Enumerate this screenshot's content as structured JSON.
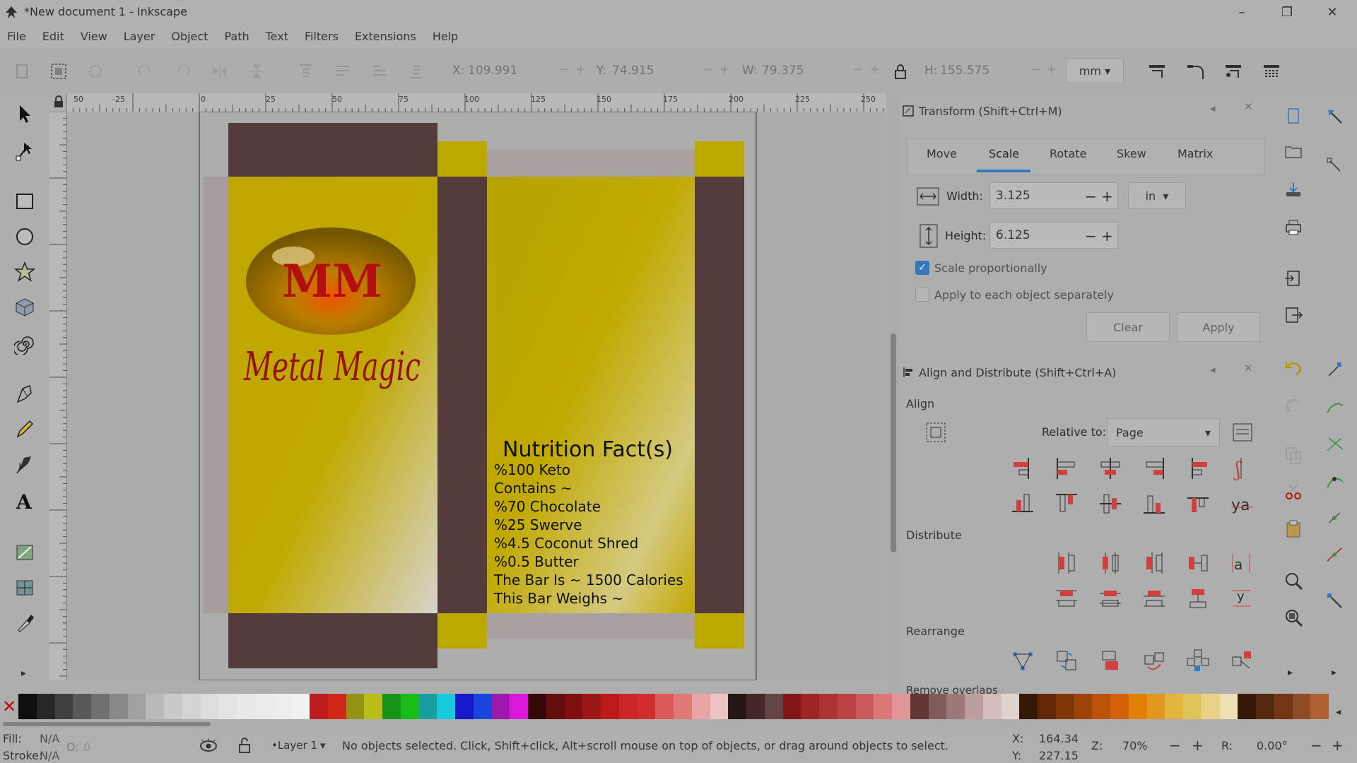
{
  "window": {
    "title": "*New document 1 - Inkscape",
    "controls": [
      "–",
      "❐",
      "✕"
    ]
  },
  "menu": [
    "File",
    "Edit",
    "View",
    "Layer",
    "Object",
    "Path",
    "Text",
    "Filters",
    "Extensions",
    "Help"
  ],
  "toolbar": {
    "x_label": "X:",
    "x_value": "109.991",
    "y_label": "Y:",
    "y_value": "74.915",
    "w_label": "W:",
    "w_value": "79.375",
    "h_label": "H:",
    "h_value": "155.575",
    "unit": "mm"
  },
  "ruler_top": [
    "50",
    "-25",
    "0",
    "25",
    "50",
    "75",
    "100",
    "125",
    "150",
    "175",
    "200",
    "225",
    "250"
  ],
  "artwork": {
    "logo_text": "MM",
    "brand_text": "Metal Magic",
    "nutrition": {
      "title": "Nutrition Fact(s)",
      "lines": [
        "%100 Keto",
        "Contains ~",
        "%70 Chocolate",
        "%25 Swerve",
        "%4.5 Coconut Shred",
        "%0.5 Butter",
        "The Bar Is ~ 1500 Calories",
        "This Bar Weighs ~"
      ]
    }
  },
  "transform": {
    "title": "Transform (Shift+Ctrl+M)",
    "tabs": [
      "Move",
      "Scale",
      "Rotate",
      "Skew",
      "Matrix"
    ],
    "active_tab": "Scale",
    "width_label": "Width:",
    "width_value": "3.125",
    "height_label": "Height:",
    "height_value": "6.125",
    "unit": "in",
    "scale_proportionally": "Scale proportionally",
    "apply_each": "Apply to each object separately",
    "clear": "Clear",
    "apply": "Apply"
  },
  "align": {
    "title": "Align and Distribute (Shift+Ctrl+A)",
    "align_label": "Align",
    "relative_label": "Relative to:",
    "relative_value": "Page",
    "distribute_label": "Distribute",
    "rearrange_label": "Rearrange",
    "remove_overlaps_label": "Remove overlaps"
  },
  "palette": [
    "#101010",
    "#2a2a2a",
    "#444444",
    "#5e5e5e",
    "#787878",
    "#929292",
    "#acacac",
    "#c6c6c6",
    "#d6d6d6",
    "#e2e2e2",
    "#eaeaea",
    "#f2f2f2",
    "#f8f8f8",
    "#fbfbfb",
    "#fdfdfd",
    "#ffffff",
    "#c81d1d",
    "#e02a1a",
    "#9c9c18",
    "#c8c81a",
    "#1a9c1a",
    "#1ac81a",
    "#1aa8a8",
    "#1ad8e8",
    "#1a1ad8",
    "#1a4ae8",
    "#a81ab8",
    "#e81ae8",
    "#3a0808",
    "#6a0e0e",
    "#8a1010",
    "#a81818",
    "#c81c1c",
    "#d82a2a",
    "#e03030",
    "#e86060",
    "#f08080",
    "#f8b0b0",
    "#fad0d0",
    "#2a1818",
    "#4a2a2a",
    "#6a4a4a",
    "#8a1818",
    "#a82828",
    "#b83838",
    "#c84848",
    "#d86060",
    "#e88080",
    "#f0a0a0",
    "#6a3a3a",
    "#8a6060",
    "#a88080",
    "#c8a8a8",
    "#e0c8c8",
    "#f0e0e0",
    "#3a1a08",
    "#6a2a08",
    "#8a3a08",
    "#a84808",
    "#c85808",
    "#e06808",
    "#f08808",
    "#f0a020",
    "#f0c040",
    "#f0d060",
    "#f8e090",
    "#faf0c0",
    "#3a1a08",
    "#5a2a10",
    "#7a3a18",
    "#9a5028",
    "#b86838"
  ],
  "status": {
    "fill_label": "Fill:",
    "fill_value": "N/A",
    "stroke_label": "Stroke:",
    "stroke_value": "N/A",
    "opacity_label": "O:",
    "opacity_value": "0",
    "layer": "•Layer 1",
    "message": "No objects selected. Click, Shift+click, Alt+scroll mouse on top of objects, or drag around objects to select.",
    "x_label": "X:",
    "x_value": "164.34",
    "y_label": "Y:",
    "y_value": "227.15",
    "zoom_label": "Z:",
    "zoom_value": "70%",
    "rotate_label": "R:",
    "rotate_value": "0.00°"
  }
}
